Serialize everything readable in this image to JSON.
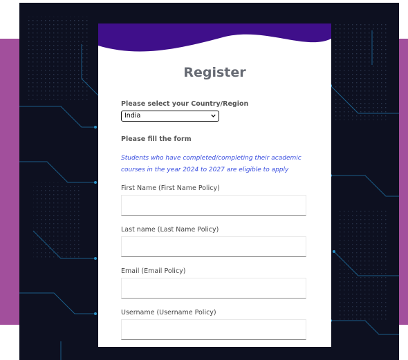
{
  "register": {
    "title": "Register",
    "country_label": "Please select your Country/Region",
    "country_selected": "India",
    "form_heading": "Please fill the form",
    "eligibility_note": "Students who have completed/completing their academic courses in the year 2024 to 2027 are eligible to apply",
    "fields": [
      {
        "label": "First Name (First Name Policy)",
        "value": ""
      },
      {
        "label": "Last name (Last Name Policy)",
        "value": ""
      },
      {
        "label": "Email (Email Policy)",
        "value": ""
      },
      {
        "label": "Username (Username Policy)",
        "value": ""
      }
    ]
  },
  "colors": {
    "accent_band": "#a24f9c",
    "header_wave": "#3f0f8a",
    "circuit_bg": "#0d1020",
    "note_text": "#3a4fe0"
  }
}
